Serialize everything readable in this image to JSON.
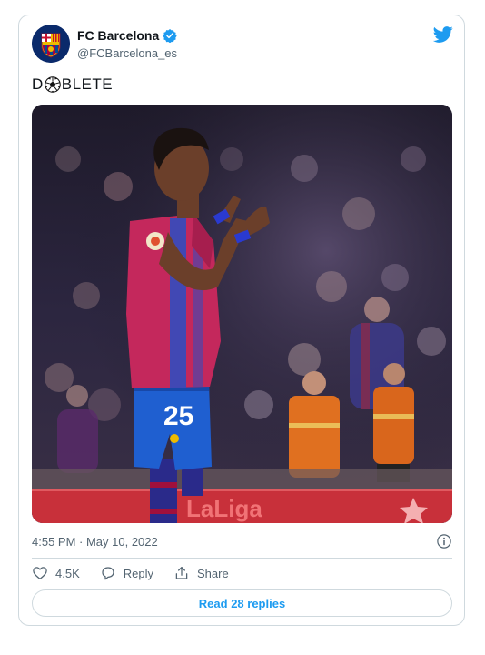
{
  "author": {
    "display_name": "FC Barcelona",
    "handle": "@FCBarcelona_es",
    "verified": true
  },
  "tweet": {
    "text_before": "D",
    "text_after": "BLETE",
    "text_icon": "soccer-ball-icon"
  },
  "photo": {
    "jersey_number": "25",
    "board_text": "LaLiga"
  },
  "meta": {
    "timestamp": "4:55 PM · May 10, 2022"
  },
  "actions": {
    "like_count": "4.5K",
    "reply_label": "Reply",
    "share_label": "Share"
  },
  "read_replies_label": "Read 28 replies",
  "colors": {
    "twitter_blue": "#1d9bf0",
    "text_secondary": "#536471",
    "border": "#cfd9de"
  }
}
